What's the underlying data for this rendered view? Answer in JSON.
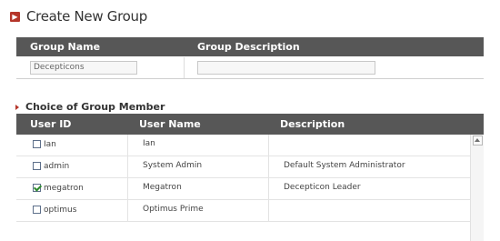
{
  "page": {
    "title": "Create New Group"
  },
  "group_header": {
    "name_label": "Group Name",
    "description_label": "Group Description"
  },
  "group_form": {
    "name_value": "Decepticons",
    "description_value": ""
  },
  "member_section": {
    "title": "Choice of Group Member"
  },
  "member_table": {
    "columns": [
      "User ID",
      "User Name",
      "Description"
    ],
    "rows": [
      {
        "id": "Ian",
        "name": "Ian",
        "description": "",
        "checked": false
      },
      {
        "id": "admin",
        "name": "System Admin",
        "description": "Default System Administrator",
        "checked": false
      },
      {
        "id": "megatron",
        "name": "Megatron",
        "description": "Decepticon Leader",
        "checked": true
      },
      {
        "id": "optimus",
        "name": "Optimus Prime",
        "description": "",
        "checked": false
      }
    ]
  },
  "colors": {
    "header_bar": "#575757",
    "accent": "#b5352a",
    "check": "#2d8a2d"
  }
}
